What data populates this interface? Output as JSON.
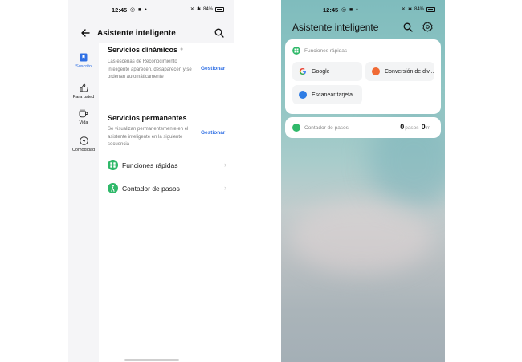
{
  "status_bar": {
    "time": "12:45",
    "battery_percent": "84%"
  },
  "left_screen": {
    "title": "Asistente inteligente",
    "nav": [
      {
        "label": "Suscrito",
        "icon": "bookmark-icon",
        "active": true
      },
      {
        "label": "Para usted",
        "icon": "thumbs-up-icon",
        "active": false
      },
      {
        "label": "Vida",
        "icon": "coffee-cup-icon",
        "active": false
      },
      {
        "label": "Comodidad",
        "icon": "lightning-icon",
        "active": false
      }
    ],
    "dynamic": {
      "title": "Servicios dinámicos",
      "description": "Las escenas de Reconocimiento inteligente aparecen, desaparecen y se ordenan automáticamente",
      "manage_label": "Gestionar"
    },
    "permanent": {
      "title": "Servicios permanentes",
      "description": "Se visualizan permanentemente en el asistente inteligente en la siguiente secuencia",
      "manage_label": "Gestionar",
      "items": [
        {
          "label": "Funciones rápidas",
          "icon": "quick-functions-icon"
        },
        {
          "label": "Contador de pasos",
          "icon": "walking-icon"
        }
      ]
    },
    "accent_color": "#2f6fe4",
    "item_icon_color": "#30b96a"
  },
  "right_screen": {
    "title": "Asistente inteligente",
    "quick_functions": {
      "header": "Funciones rápidas",
      "buttons": [
        {
          "label": "Google",
          "icon": "google-icon"
        },
        {
          "label": "Conversión de div...",
          "icon": "currency-conversion-icon"
        },
        {
          "label": "Escanear tarjeta",
          "icon": "scan-card-icon"
        }
      ]
    },
    "step_counter": {
      "header": "Contador de pasos",
      "steps_value": "0",
      "steps_unit": "pasos",
      "distance_value": "0",
      "distance_unit": "m"
    }
  }
}
